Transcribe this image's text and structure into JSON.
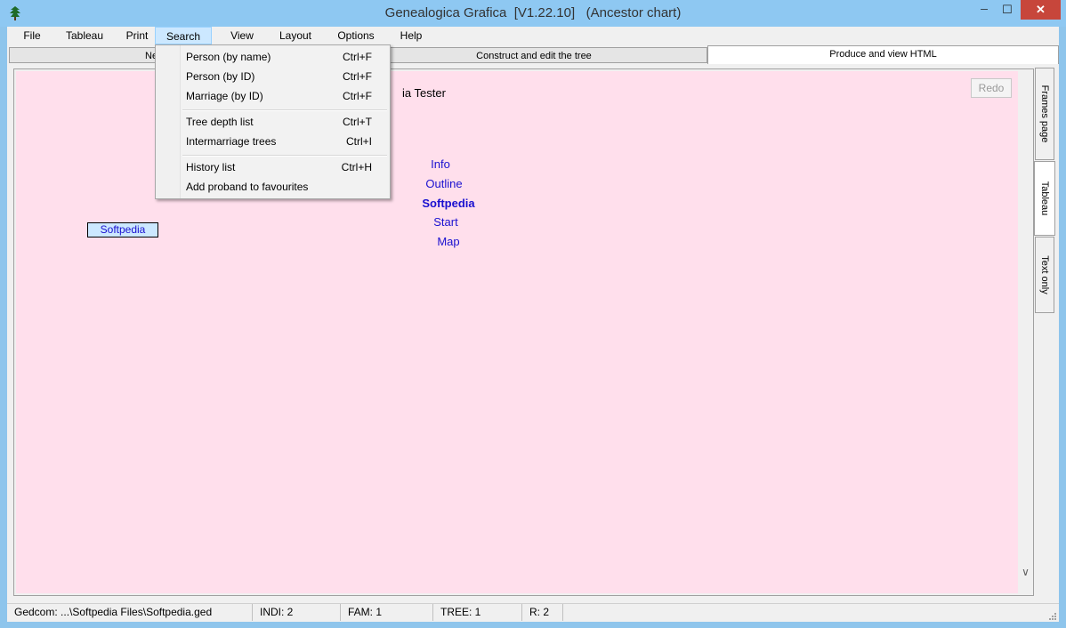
{
  "window": {
    "title": "Genealogica Grafica  [V1.22.10]   (Ancestor chart)",
    "minimize_glyph": "─",
    "maximize_glyph": "☐",
    "close_glyph": "✕"
  },
  "menubar": [
    "File",
    "Tableau",
    "Print",
    "Search",
    "View",
    "Layout",
    "Options",
    "Help"
  ],
  "top_tabs": [
    "Ne",
    "Construct and edit the tree",
    "Produce and view HTML"
  ],
  "search_menu": {
    "group1": [
      {
        "label": "Person (by name)",
        "shortcut": "Ctrl+F"
      },
      {
        "label": "Person (by ID)",
        "shortcut": "Ctrl+F"
      },
      {
        "label": "Marriage (by ID)",
        "shortcut": "Ctrl+F"
      }
    ],
    "group2": [
      {
        "label": "Tree depth list",
        "shortcut": "Ctrl+T"
      },
      {
        "label": "Intermarriage trees",
        "shortcut": "Ctrl+I"
      }
    ],
    "group3": [
      {
        "label": "History list",
        "shortcut": "Ctrl+H"
      },
      {
        "label": "Add proband to favourites",
        "shortcut": ""
      }
    ]
  },
  "content": {
    "redo_label": "Redo",
    "person_name_partial": "ia Tester",
    "links": [
      "Info",
      "Outline",
      "Softpedia",
      "Start",
      "Map"
    ],
    "person_box": "Softpedia",
    "scroll_down_glyph": "∨"
  },
  "side_tabs": [
    "Frames page",
    "Tableau",
    "Text only"
  ],
  "statusbar": {
    "gedcom": "Gedcom: ...\\Softpedia Files\\Softpedia.ged",
    "indi": "INDI:  2",
    "fam": "FAM:  1",
    "tree": "TREE:  1",
    "r": "R:  2"
  },
  "colors": {
    "titlebar": "#8ec8f2",
    "content_bg": "#ffdfec",
    "link": "#1a10d0",
    "close_button": "#c7463b",
    "menu_highlight": "#cce8ff"
  }
}
